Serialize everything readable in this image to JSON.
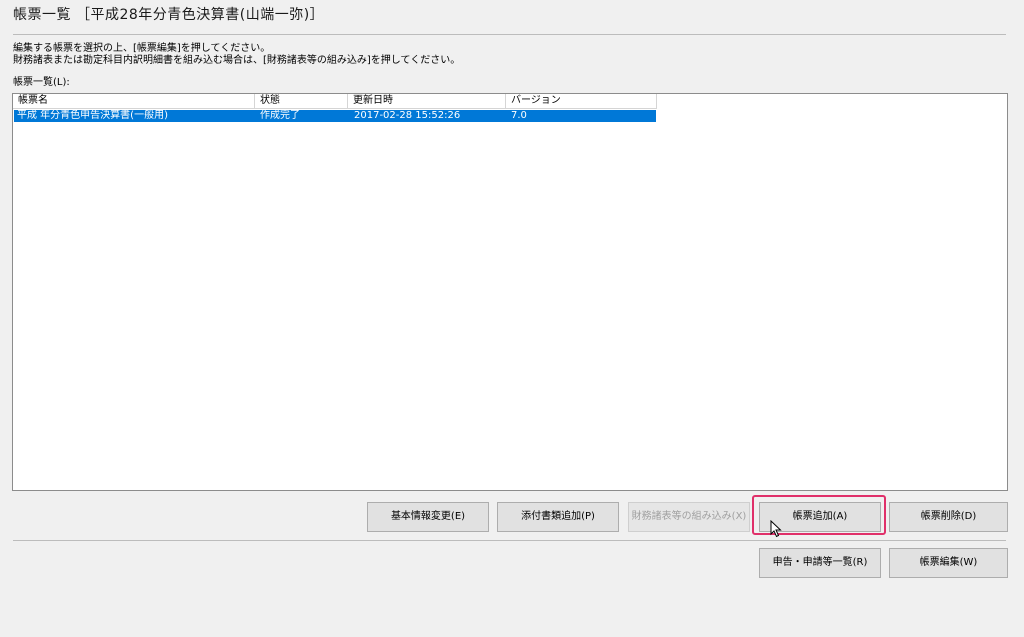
{
  "window": {
    "title": "帳票一覧 ［平成28年分青色決算書(山端一弥)］"
  },
  "instructions": {
    "line1": "編集する帳票を選択の上、[帳票編集]を押してください。",
    "line2": "財務諸表または勘定科目内訳明細書を組み込む場合は、[財務諸表等の組み込み]を押してください。"
  },
  "list": {
    "label": "帳票一覧(L):",
    "columns": [
      "帳票名",
      "状態",
      "更新日時",
      "バージョン"
    ],
    "rows": [
      {
        "name": "平成 年分青色申告決算書(一般用)",
        "status": "作成完了",
        "updated": "2017-02-28 15:52:26",
        "version": "7.0",
        "selected": true
      }
    ]
  },
  "buttons": {
    "basic_info": "基本情報変更(E)",
    "add_attachment": "添付書類追加(P)",
    "import_financial": "財務諸表等の組み込み(X)",
    "add_form": "帳票追加(A)",
    "delete_form": "帳票削除(D)",
    "declaration_list": "申告・申請等一覧(R)",
    "edit_form": "帳票編集(W)"
  },
  "colors": {
    "selection": "#0078d7",
    "highlight": "#e0306a"
  }
}
